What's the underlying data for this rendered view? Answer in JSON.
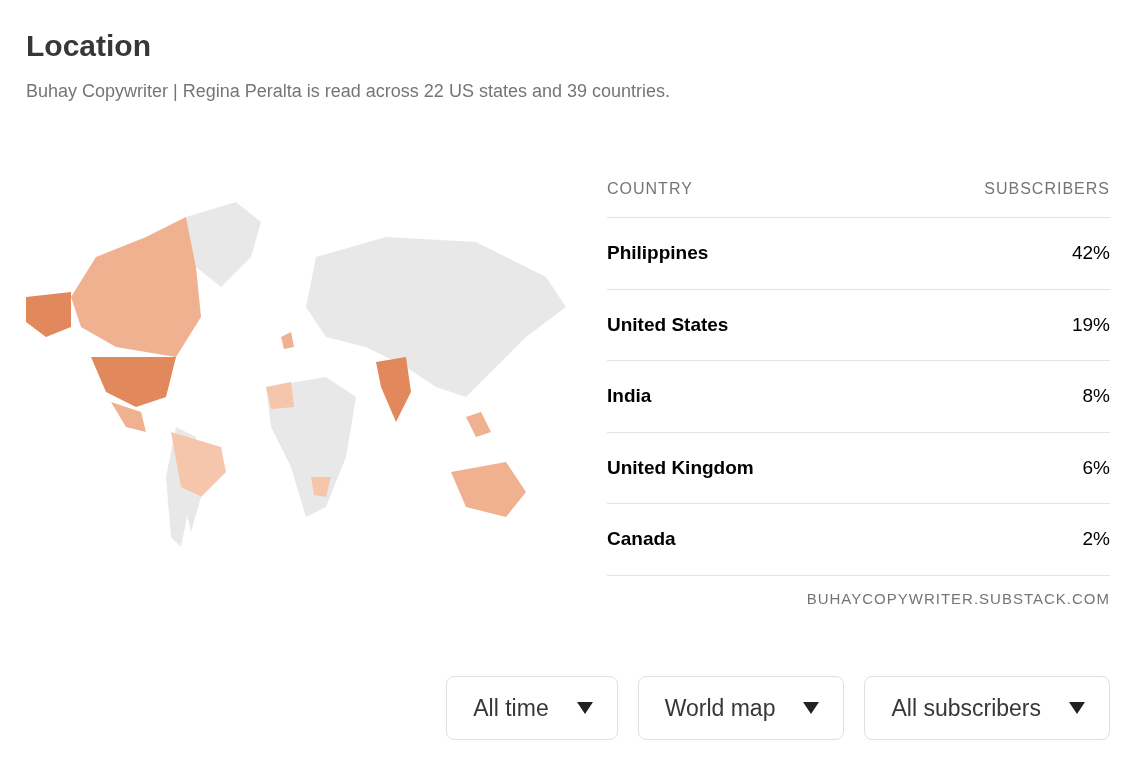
{
  "title": "Location",
  "subtitle": "Buhay Copywriter | Regina Peralta is read across 22 US states and 39 countries.",
  "table": {
    "columns": [
      "COUNTRY",
      "SUBSCRIBERS"
    ],
    "rows": [
      {
        "country": "Philippines",
        "share": "42%"
      },
      {
        "country": "United States",
        "share": "19%"
      },
      {
        "country": "India",
        "share": "8%"
      },
      {
        "country": "United Kingdom",
        "share": "6%"
      },
      {
        "country": "Canada",
        "share": "2%"
      }
    ]
  },
  "source": "BUHAYCOPYWRITER.SUBSTACK.COM",
  "filters": [
    {
      "label": "All time"
    },
    {
      "label": "World map"
    },
    {
      "label": "All subscribers"
    }
  ]
}
